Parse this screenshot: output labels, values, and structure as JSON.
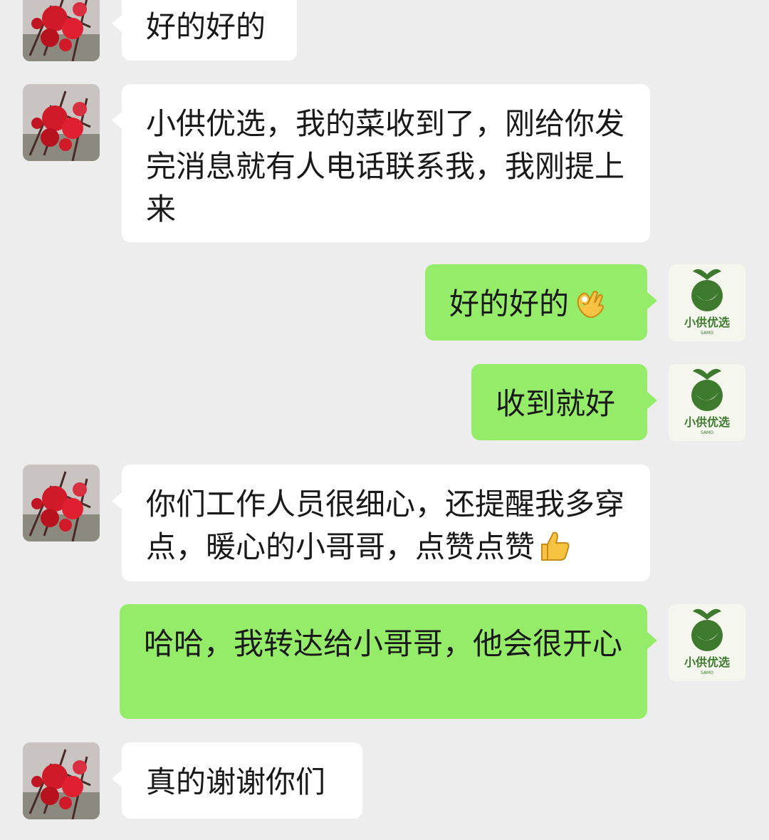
{
  "chat": {
    "colors": {
      "background": "#ededed",
      "incoming_bubble": "#ffffff",
      "outgoing_bubble": "#95ec69",
      "brand_green": "#3d7a2e"
    },
    "store_avatar": {
      "brand_name": "小供优选",
      "brand_sub": "SAMO",
      "icon": "leaf-brand-logo"
    },
    "customer_avatar": {
      "icon": "red-flower-photo"
    },
    "messages": [
      {
        "from": "customer",
        "text": "好的好的"
      },
      {
        "from": "customer",
        "text": "小供优选，我的菜收到了，刚给你发完消息就有人电话联系我，我刚提上来"
      },
      {
        "from": "store",
        "text": "好的好的",
        "emoji": "ok-hand-emoji"
      },
      {
        "from": "store",
        "text": "收到就好"
      },
      {
        "from": "customer",
        "text": "你们工作人员很细心，还提醒我多穿点，暖心的小哥哥，点赞点赞",
        "emoji": "thumbs-up-emoji"
      },
      {
        "from": "store",
        "text": "哈哈，我转达给小哥哥，他会很开心"
      },
      {
        "from": "customer",
        "text": "真的谢谢你们"
      }
    ]
  }
}
